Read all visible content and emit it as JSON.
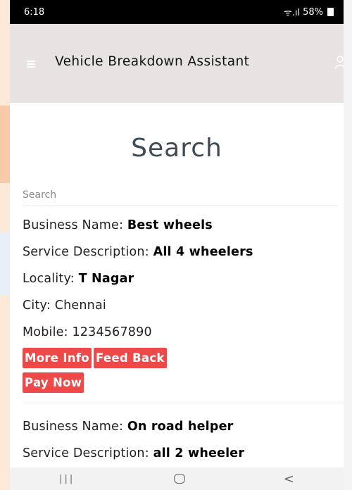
{
  "status_bar": {
    "time": "6:18",
    "signal": "ᯤ.ıl",
    "battery_percent": "58%"
  },
  "header": {
    "title": "Vehicle Breakdown Assistant",
    "menu_icon": "hamburger-icon",
    "user_icon": "user-icon"
  },
  "page": {
    "title": "Search"
  },
  "search": {
    "placeholder": "Search"
  },
  "labels": {
    "business_name": "Business Name: ",
    "service_description": "Service Description: ",
    "locality": "Locality: ",
    "city": "City: ",
    "mobile": "Mobile: "
  },
  "results": [
    {
      "business_name": "Best wheels",
      "service_description": "All 4 wheelers",
      "locality": "T Nagar",
      "city": "Chennai",
      "mobile": "1234567890",
      "more_info_label": "More Info",
      "feedback_label": "Feed Back",
      "pay_now_label": "Pay Now"
    },
    {
      "business_name": "On road helper",
      "service_description": "all 2 wheeler"
    }
  ],
  "colors": {
    "accent": "#ee4949",
    "header_bg": "#e8e3e3"
  },
  "nav": {
    "recents": "|||",
    "back": "<"
  }
}
